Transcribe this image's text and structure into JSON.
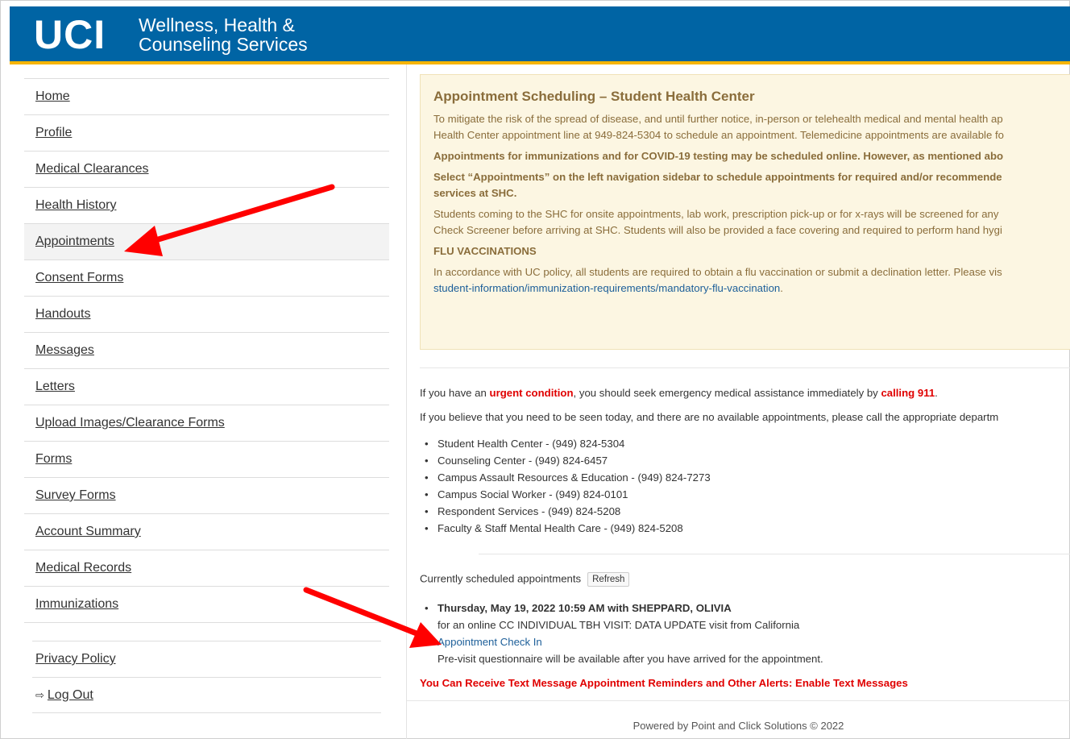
{
  "header": {
    "logo": "UCI",
    "title_line1": "Wellness, Health &",
    "title_line2": "Counseling Services"
  },
  "sidebar": {
    "items": [
      {
        "label": "Home"
      },
      {
        "label": "Profile"
      },
      {
        "label": "Medical Clearances"
      },
      {
        "label": "Health History"
      },
      {
        "label": "Appointments"
      },
      {
        "label": "Consent Forms"
      },
      {
        "label": "Handouts"
      },
      {
        "label": "Messages"
      },
      {
        "label": "Letters"
      },
      {
        "label": "Upload Images/Clearance Forms"
      },
      {
        "label": "Forms"
      },
      {
        "label": "Survey Forms"
      },
      {
        "label": "Account Summary"
      },
      {
        "label": "Medical Records"
      },
      {
        "label": "Immunizations"
      }
    ],
    "bottom": {
      "privacy": "Privacy Policy",
      "logout": "Log Out",
      "logout_icon": "sign-out-icon"
    }
  },
  "notice": {
    "title": "Appointment Scheduling – Student Health Center",
    "p1_line1": "To mitigate the risk of the spread of disease, and until further notice, in-person or telehealth medical and mental health ap",
    "p1_line2": "Health Center appointment line at 949-824-5304 to schedule an appointment. Telemedicine appointments are available fo",
    "p2": "Appointments for immunizations and for COVID-19 testing may be scheduled online. However, as mentioned abo",
    "p3_line1": "Select “Appointments” on the left navigation sidebar to schedule appointments for required and/or recommende",
    "p3_line2": "services at SHC.",
    "p4_line1": "Students coming to the SHC for onsite appointments, lab work, prescription pick-up or for x-rays will be screened for any",
    "p4_line2": "Check Screener before arriving at SHC. Students will also be provided a face covering and required to perform hand hygi",
    "flu_heading": "FLU VACCINATIONS",
    "p5_line1": "In accordance with UC policy, all students are required to obtain a flu vaccination or submit a declination letter. Please vis",
    "p5_link": "student-information/immunization-requirements/mandatory-flu-vaccination",
    "p5_end": "."
  },
  "urgent": {
    "prefix": "If you have an ",
    "condition": "urgent condition",
    "middle": ", you should seek emergency medical assistance immediately by ",
    "call": "calling 911",
    "suffix": "."
  },
  "seen_today": "If you believe that you need to be seen today, and there are no available appointments, please call the appropriate departm",
  "departments": [
    "Student Health Center - (949) 824-5304",
    "Counseling Center - (949) 824-6457",
    "Campus Assault Resources & Education - (949) 824-7273",
    "Campus Social Worker - (949) 824-0101",
    "Respondent Services - (949) 824-5208",
    "Faculty & Staff Mental Health Care - (949) 824-5208"
  ],
  "scheduled": {
    "label": "Currently scheduled appointments",
    "refresh": "Refresh",
    "appointment": {
      "when": "Thursday, May 19, 2022 10:59 AM with SHEPPARD, OLIVIA",
      "detail": "for an online CC INDIVIDUAL TBH VISIT: DATA UPDATE visit from California",
      "checkin": "Appointment Check In",
      "note": "Pre-visit questionnaire will be available after you have arrived for the appointment."
    }
  },
  "text_alert": "You Can Receive Text Message Appointment Reminders and Other Alerts: Enable Text Messages",
  "footer": "Powered by Point and Click Solutions © 2022",
  "colors": {
    "header_blue": "#0064a4",
    "header_gold": "#f6b400",
    "alert_red": "#e00000",
    "arrow_red": "#ff0000"
  }
}
